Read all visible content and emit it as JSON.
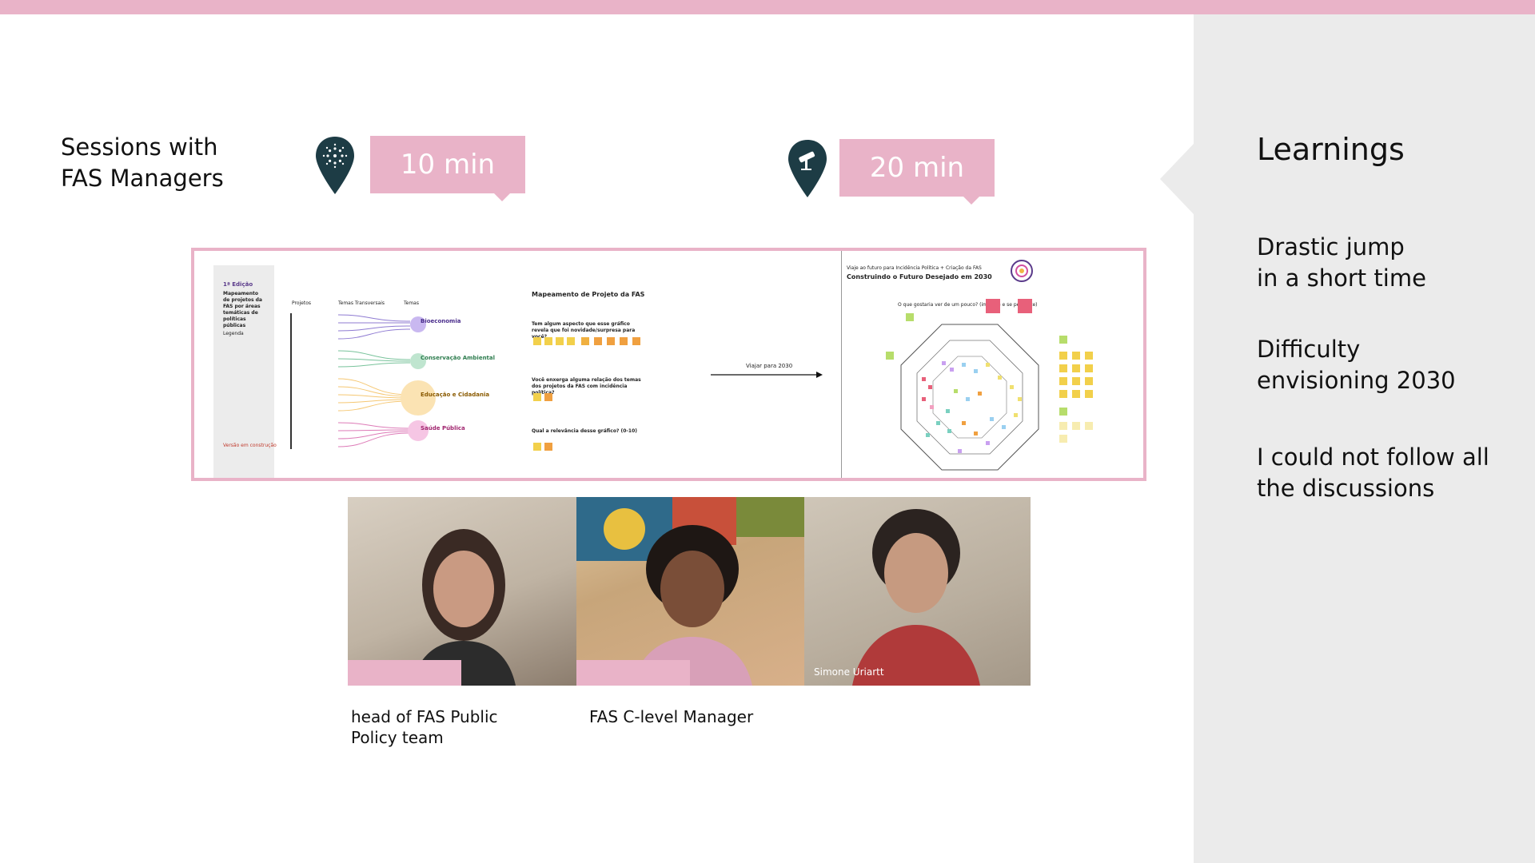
{
  "heading": "Sessions with\nFAS Managers",
  "badges": {
    "first": "10 min",
    "second": "20 min"
  },
  "learnings": {
    "title": "Learnings",
    "items": [
      "Drastic jump\nin a short time",
      "Difficulty\nenvisioning 2030",
      "I could not follow all\nthe discussions"
    ]
  },
  "board": {
    "panel1": {
      "edition": "1ª Edição",
      "title": "Mapeamento de projetos da FAS por áreas temáticas de políticas públicas",
      "legend": "Legenda",
      "cols": [
        "Projetos",
        "Temas Transversais",
        "Temas"
      ],
      "themes": [
        "Bioeconomia",
        "Conservação Ambiental",
        "Educação e Cidadania",
        "Saúde Pública"
      ],
      "footer": "Versão em construção"
    },
    "panel2": {
      "title": "Mapeamento de Projeto da FAS",
      "q1": "Tem algum aspecto que esse gráfico revela que foi novidade/surpresa para você?",
      "q2": "Você enxerga alguma relação dos temas dos projetos da FAS com incidência política?",
      "q3": "Qual a relevância desse gráfico? (0-10)",
      "arrow_label": "Viajar para 2030"
    },
    "panel3": {
      "pretitle": "Viaje ao futuro para Incidência Política + Criação da FAS",
      "title": "Construindo o Futuro Desejado em 2030",
      "subtitle": "O que gostaria ver de um pouco? (imagine e se pergunte)"
    }
  },
  "videos": [
    {
      "name": ""
    },
    {
      "name": ""
    },
    {
      "name": "Simone Uriartt"
    }
  ],
  "captions": [
    "head of FAS Public\nPolicy team",
    "FAS C-level Manager"
  ],
  "colors": {
    "accent": "#e9b3c8",
    "pin": "#1d3c45",
    "panel": "#ebebeb"
  },
  "icons": [
    "sun-dots-icon",
    "telescope-icon"
  ]
}
